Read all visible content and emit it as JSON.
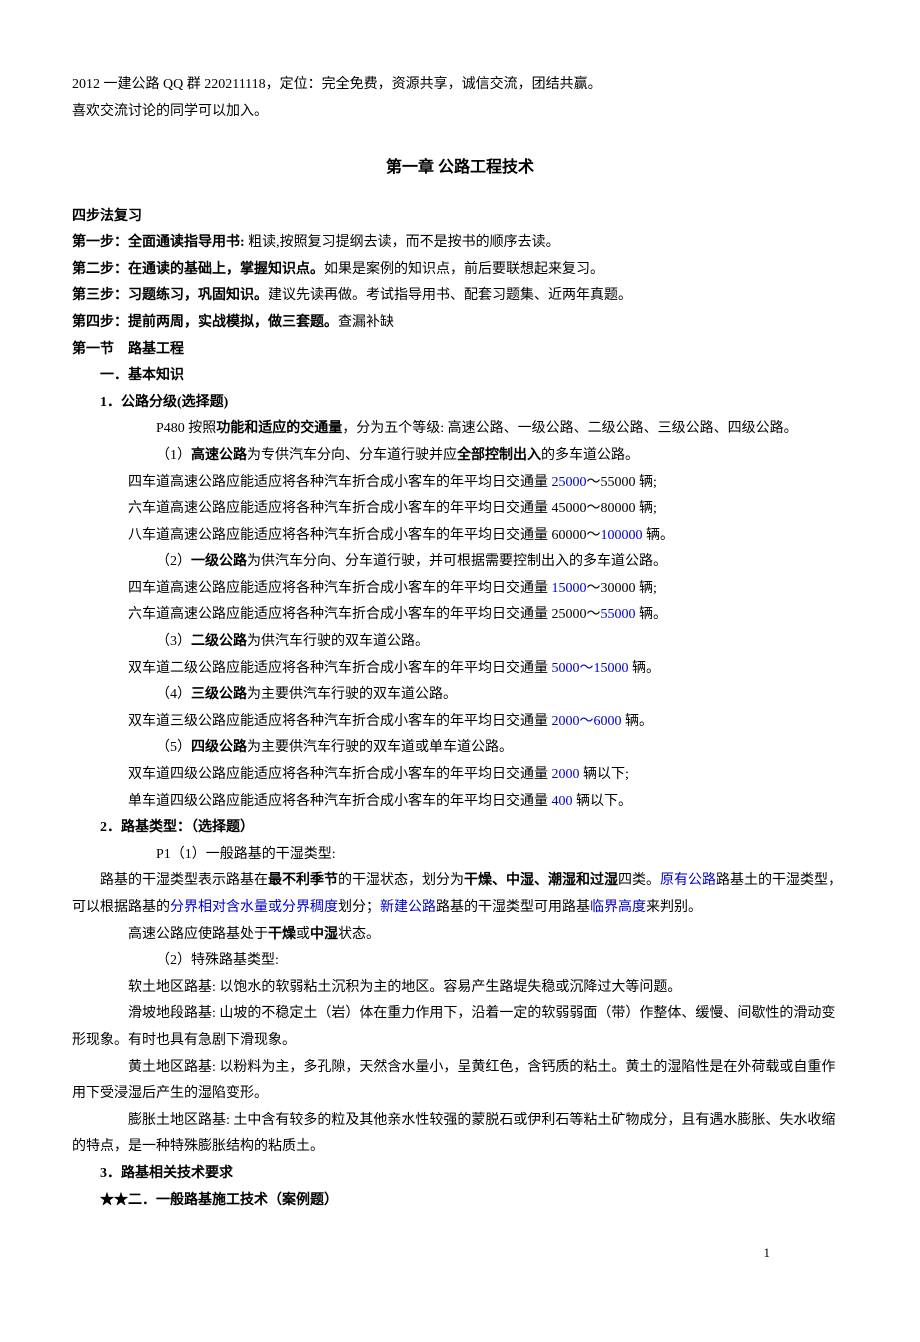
{
  "intro": {
    "line1": "2012 一建公路 QQ 群 220211118，定位：完全免费，资源共享，诚信交流，团结共赢。",
    "line2": "喜欢交流讨论的同学可以加入。"
  },
  "chapter_title": "第一章 公路工程技术",
  "study": {
    "heading": "四步法复习",
    "step1_b": "第一步：全面通读指导用书: ",
    "step1_t": "粗读,按照复习提纲去读，而不是按书的顺序去读。",
    "step2_b": "第二步：在通读的基础上，掌握知识点。",
    "step2_t": "如果是案例的知识点，前后要联想起来复习。",
    "step3_b": "第三步：习题练习，巩固知识。",
    "step3_t": "建议先读再做。考试指导用书、配套习题集、近两年真题。",
    "step4_b": "第四步：提前两周，实战模拟，做三套题。",
    "step4_t": "查漏补缺"
  },
  "s1": {
    "title": "第一节　路基工程",
    "h1": "一．基本知识",
    "p1_title": "1．公路分级(选择题)",
    "p1_lead_a": "P480 按照",
    "p1_lead_b": "功能和适应的交通量",
    "p1_lead_c": "，分为五个等级: 高速公路、一级公路、二级公路、三级公路、四级公路。",
    "r1a": "（1）",
    "r1b": "高速公路",
    "r1c": "为专供汽车分向、分车道行驶并应",
    "r1d": "全部控制出入",
    "r1e": "的多车道公路。",
    "r1_l1_a": "四车道高速公路应能适应将各种汽车折合成小客车的年平均日交通量 ",
    "r1_l1_b": "25000",
    "r1_l1_c": "～55000 辆;",
    "r1_l2": "六车道高速公路应能适应将各种汽车折合成小客车的年平均日交通量 45000～80000 辆;",
    "r1_l3_a": "八车道高速公路应能适应将各种汽车折合成小客车的年平均日交通量 60000～",
    "r1_l3_b": "100000",
    "r1_l3_c": " 辆。",
    "r2a": "（2）",
    "r2b": "一级公路",
    "r2c": "为供汽车分向、分车道行驶，并可根据需要控制出入的多车道公路。",
    "r2_l1_a": "四车道高速公路应能适应将各种汽车折合成小客车的年平均日交通量 ",
    "r2_l1_b": "15000",
    "r2_l1_c": "～30000 辆;",
    "r2_l2_a": "六车道高速公路应能适应将各种汽车折合成小客车的年平均日交通量 25000～",
    "r2_l2_b": "55000",
    "r2_l2_c": " 辆。",
    "r3a": "（3）",
    "r3b": "二级公路",
    "r3c": "为供汽车行驶的双车道公路。",
    "r3_l1_a": "双车道二级公路应能适应将各种汽车折合成小客车的年平均日交通量 ",
    "r3_l1_b": "5000～15000",
    "r3_l1_c": " 辆。",
    "r4a": "（4）",
    "r4b": "三级公路",
    "r4c": "为主要供汽车行驶的双车道公路。",
    "r4_l1_a": "双车道三级公路应能适应将各种汽车折合成小客车的年平均日交通量 ",
    "r4_l1_b": "2000～6000",
    "r4_l1_c": " 辆。",
    "r5a": "（5）",
    "r5b": "四级公路",
    "r5c": "为主要供汽车行驶的双车道或单车道公路。",
    "r5_l1_a": "双车道四级公路应能适应将各种汽车折合成小客车的年平均日交通量 ",
    "r5_l1_b": "2000",
    "r5_l1_c": " 辆以下;",
    "r5_l2_a": "单车道四级公路应能适应将各种汽车折合成小客车的年平均日交通量 ",
    "r5_l2_b": "400",
    "r5_l2_c": " 辆以下。",
    "p2_title": "2．路基类型：（选择题）",
    "p2_l1": "P1（1）一般路基的干湿类型:",
    "p2_body_a": "路基的干湿类型表示路基在",
    "p2_body_b": "最不利季节",
    "p2_body_c": "的干湿状态，划分为",
    "p2_body_d": "干燥、中湿、潮湿和过湿",
    "p2_body_e": "四类。",
    "p2_body_f": "原有公路",
    "p2_body_g": "路基土的干湿类型，可以根据路基的",
    "p2_body_h": "分界相对含水量或分界稠度",
    "p2_body_i": "划分；",
    "p2_body_j": "新建公路",
    "p2_body_k": "路基的干湿类型可用路基",
    "p2_body_l": "临界高度",
    "p2_body_m": "来判别。",
    "p2_hl_a": "高速公路应使路基处于",
    "p2_hl_b": "干燥",
    "p2_hl_c": "或",
    "p2_hl_d": "中湿",
    "p2_hl_e": "状态。",
    "p2_s2": "（2）特殊路基类型:",
    "soft": "软土地区路基: 以饱水的软弱粘土沉积为主的地区。容易产生路堤失稳或沉降过大等问题。",
    "slide": "滑坡地段路基: 山坡的不稳定土（岩）体在重力作用下，沿着一定的软弱弱面（带）作整体、缓慢、间歇性的滑动变形现象。有时也具有急剧下滑现象。",
    "loess": "黄土地区路基: 以粉料为主，多孔隙，天然含水量小，呈黄红色，含钙质的粘土。黄土的湿陷性是在外荷载或自重作用下受浸湿后产生的湿陷变形。",
    "exp": "膨胀土地区路基: 土中含有较多的粒及其他亲水性较强的蒙脱石或伊利石等粘土矿物成分，且有遇水膨胀、失水收缩的特点，是一种特殊膨胀结构的粘质土。",
    "p3_title": "3．路基相关技术要求",
    "h2": "★★二．一般路基施工技术（案例题）"
  },
  "page_num": "1"
}
